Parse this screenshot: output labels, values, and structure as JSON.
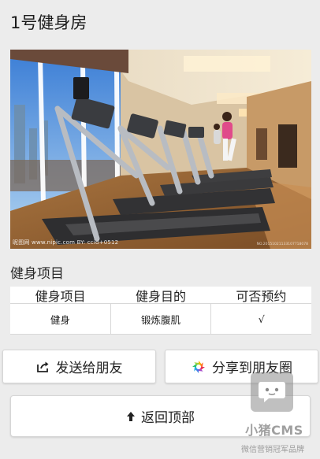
{
  "page": {
    "title": "1号健身房"
  },
  "photo": {
    "watermark_left": "昵图网 www.nipic.com    BY: ccid+0512",
    "watermark_right": "NO.20151021133107718078"
  },
  "section": {
    "title": "健身项目"
  },
  "table": {
    "headers": [
      "健身项目",
      "健身目的",
      "可否预约"
    ],
    "rows": [
      [
        "健身",
        "锻炼腹肌",
        "√"
      ]
    ]
  },
  "buttons": {
    "send": "发送给朋友",
    "share": "分享到朋友圈",
    "top": "返回顶部"
  },
  "brand": {
    "name": "小猪CMS",
    "tagline": "微信营销冠军品牌"
  }
}
